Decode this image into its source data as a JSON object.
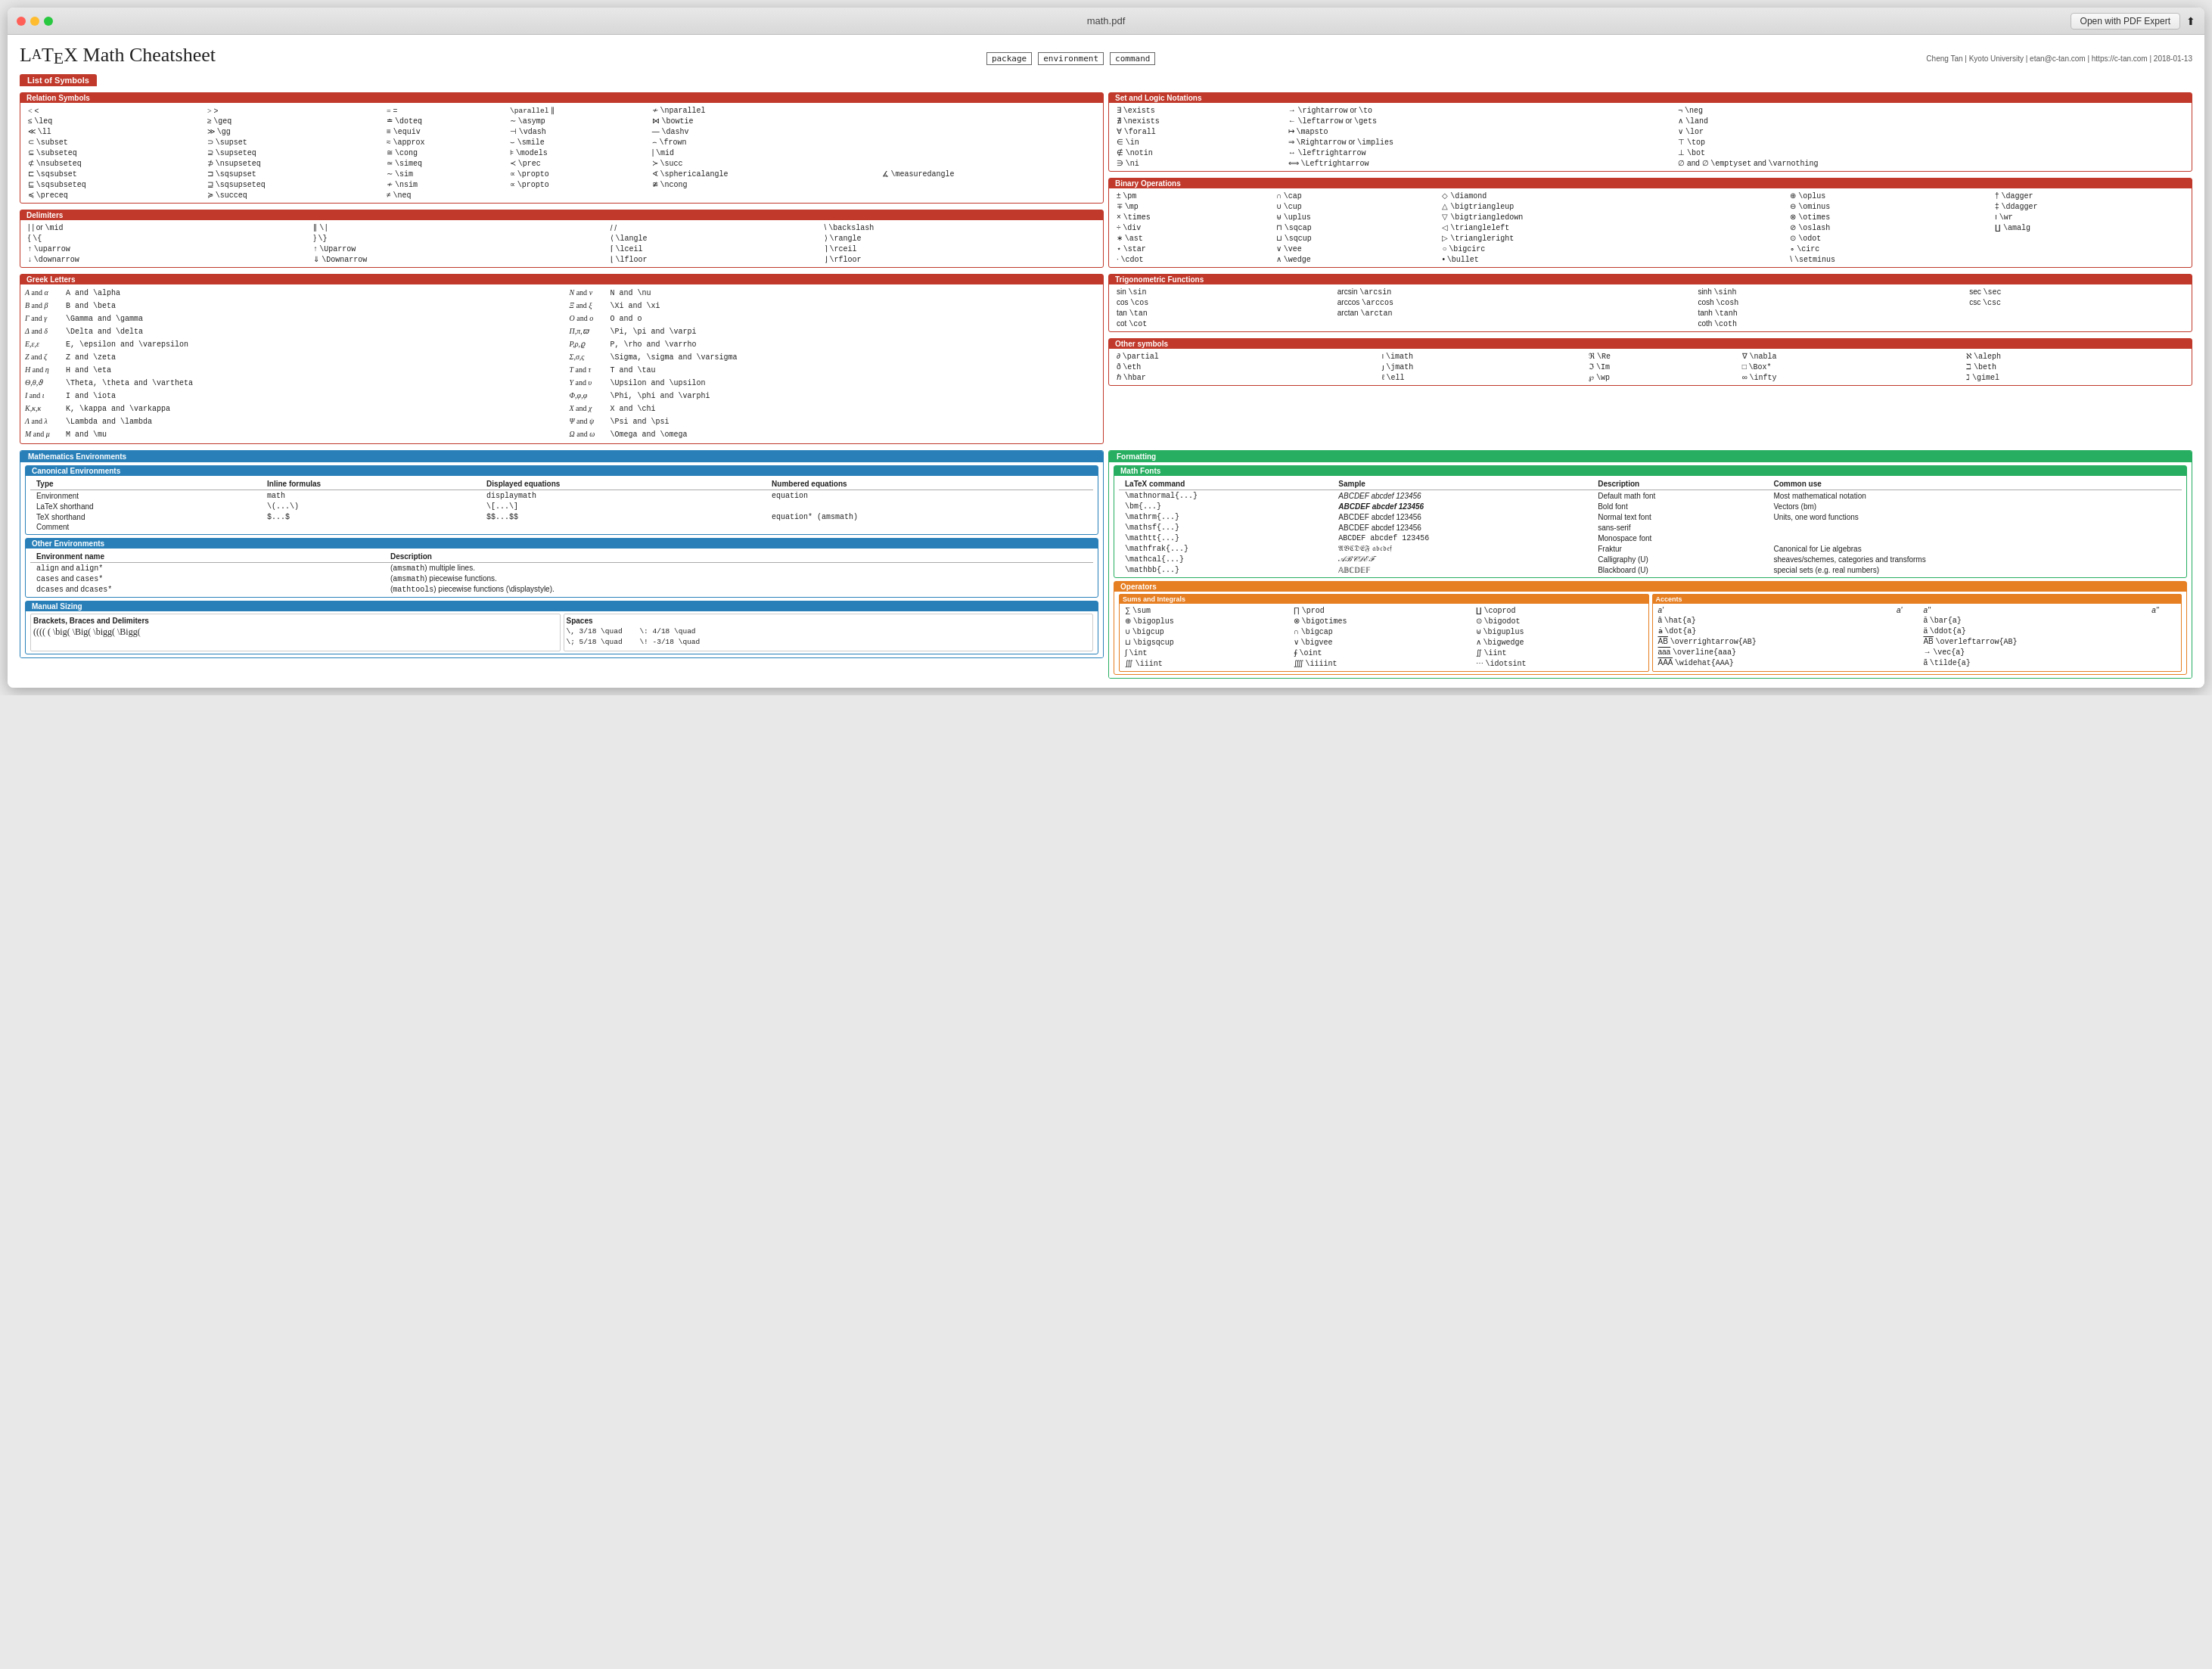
{
  "window": {
    "title": "math.pdf",
    "open_button": "Open with PDF Expert"
  },
  "doc": {
    "title": "LaTeX Math Cheatsheet",
    "commands": [
      "package",
      "environment",
      "command"
    ],
    "author": "Cheng Tan | Kyoto University | etan@c-tan.com | https://c-tan.com | 2018-01-13"
  },
  "sections": {
    "list_of_symbols": "List of Symbols",
    "relation_symbols": "Relation Symbols",
    "delimiters": "Delimiters",
    "greek_letters": "Greek Letters",
    "set_logic": "Set and Logic Notations",
    "binary_ops": "Binary Operations",
    "trig": "Trigonometric Functions",
    "other_symbols": "Other symbols",
    "math_envs": "Mathematics Environments",
    "formatting": "Formatting",
    "canonical_envs": "Canonical Environments",
    "other_envs": "Other Environments",
    "manual_sizing": "Manual Sizing",
    "operators": "Operators",
    "sums_integrals": "Sums and Integrals",
    "accents": "Accents"
  }
}
